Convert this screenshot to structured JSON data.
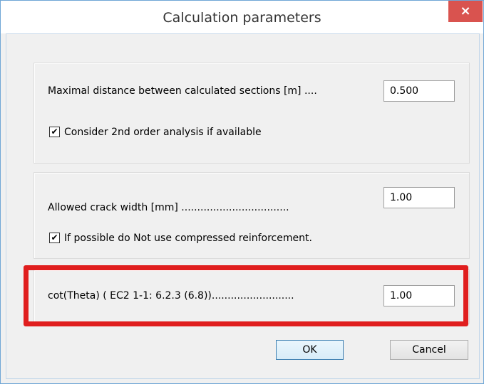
{
  "window": {
    "title": "Calculation parameters",
    "close_glyph": "×"
  },
  "section1": {
    "distance_label": "Maximal distance between calculated sections [m] ....",
    "distance_value": "0.500",
    "second_order_checked": true,
    "second_order_label": "Consider 2nd order analysis if available"
  },
  "section2": {
    "crack_label": "Allowed crack width [mm] ..................................",
    "crack_value": "1.00",
    "compressed_checked": true,
    "compressed_label": "If possible do Not use compressed reinforcement."
  },
  "section3": {
    "cot_label": "cot(Theta)  ( EC2 1-1: 6.2.3 (6.8))..........................",
    "cot_value": "1.00"
  },
  "buttons": {
    "ok_label": "OK",
    "cancel_label": "Cancel"
  },
  "icons": {
    "close": "close-icon",
    "check": "checkmark-icon"
  },
  "colors": {
    "highlight": "#e01e1e",
    "close_button": "#d9534f"
  }
}
